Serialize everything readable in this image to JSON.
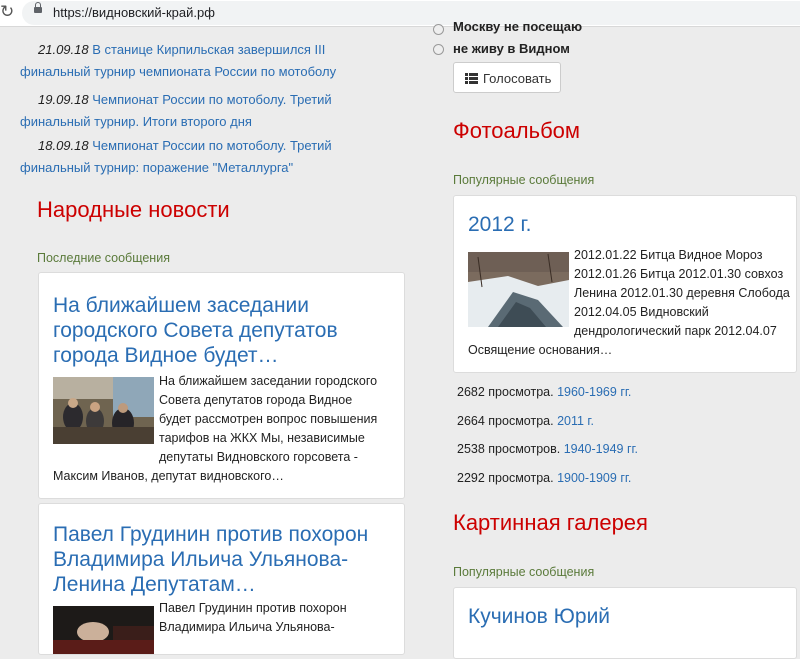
{
  "browser": {
    "url": "https://видновский-край.рф"
  },
  "news": [
    {
      "date": "21.09.18",
      "text": "В станице Кирпильская завершился III",
      "text2": "финальный турнир чемпионата России по мотоболу"
    },
    {
      "date": "19.09.18",
      "text": "Чемпионат России по мотоболу. Третий",
      "text2": "финальный турнир. Итоги второго дня"
    },
    {
      "date": "18.09.18",
      "text": "Чемпионат России по мотоболу. Третий",
      "text2": "финальный турнир: поражение \"Металлурга\""
    }
  ],
  "left": {
    "section_title": "Народные новости",
    "subhead": "Последние сообщения",
    "cards": [
      {
        "title": [
          "На ближайшем заседании",
          "городского Совета депутатов",
          "города Видное будет…"
        ],
        "text": [
          "На ближайшем заседании городского",
          "Совета депутатов города Видное",
          "будет рассмотрен вопрос повышения",
          "тарифов на ЖКХ Мы, независимые",
          "депутаты Видновского горсовета -",
          "Максим Иванов, депутат видновского…"
        ]
      },
      {
        "title": [
          "Павел Грудинин против похорон",
          "Владимира Ильича Ульянова-",
          "Ленина Депутатам…"
        ],
        "text": [
          "Павел Грудинин против похорон",
          "Владимира Ильича Ульянова-"
        ]
      }
    ]
  },
  "poll": {
    "options": [
      "Москву не посещаю",
      "не живу в Видном"
    ],
    "vote_label": "Голосовать"
  },
  "photo": {
    "section_title": "Фотоальбом",
    "subhead": "Популярные сообщения",
    "card_title": "2012 г.",
    "card_text": [
      "2012.01.22 Битца Видное Мороз",
      "2012.01.26 Битца 2012.01.30 совхоз",
      "Ленина 2012.01.30 деревня Слобода",
      "2012.04.05 Видновский",
      "дендрологический парк 2012.04.07",
      "Освящение основания…"
    ],
    "stats": [
      {
        "views": "2682 просмотра.",
        "link": "1960-1969 гг."
      },
      {
        "views": "2664 просмотра.",
        "link": "2011 г."
      },
      {
        "views": "2538 просмотров.",
        "link": "1940-1949 гг."
      },
      {
        "views": "2292 просмотра.",
        "link": "1900-1909 гг."
      }
    ]
  },
  "gallery": {
    "section_title": "Картинная галерея",
    "subhead": "Популярные сообщения",
    "card_title": "Кучинов Юрий"
  },
  "colors": {
    "accent_red": "#cc0000",
    "link_blue": "#2a6db3",
    "subhead_green": "#5a7a3a"
  }
}
